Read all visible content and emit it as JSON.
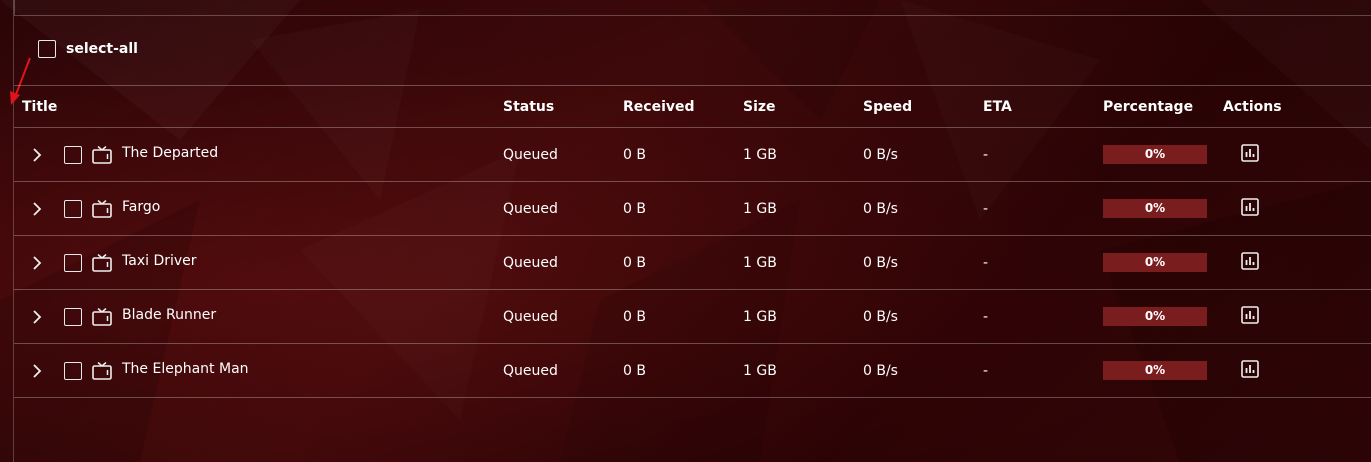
{
  "select_all_label": "select-all",
  "columns": {
    "title": "Title",
    "status": "Status",
    "received": "Received",
    "size": "Size",
    "speed": "Speed",
    "eta": "ETA",
    "percentage": "Percentage",
    "actions": "Actions"
  },
  "rows": [
    {
      "title": "The Departed",
      "status": "Queued",
      "received": "0 B",
      "size": "1 GB",
      "speed": "0 B/s",
      "eta": "-",
      "percentage": "0%",
      "progress": 0
    },
    {
      "title": "Fargo",
      "status": "Queued",
      "received": "0 B",
      "size": "1 GB",
      "speed": "0 B/s",
      "eta": "-",
      "percentage": "0%",
      "progress": 0
    },
    {
      "title": "Taxi Driver",
      "status": "Queued",
      "received": "0 B",
      "size": "1 GB",
      "speed": "0 B/s",
      "eta": "-",
      "percentage": "0%",
      "progress": 0
    },
    {
      "title": "Blade Runner",
      "status": "Queued",
      "received": "0 B",
      "size": "1 GB",
      "speed": "0 B/s",
      "eta": "-",
      "percentage": "0%",
      "progress": 0
    },
    {
      "title": "The Elephant Man",
      "status": "Queued",
      "received": "0 B",
      "size": "1 GB",
      "speed": "0 B/s",
      "eta": "-",
      "percentage": "0%",
      "progress": 0
    }
  ],
  "icons": {
    "expand": "chevron-right-icon",
    "media": "tv-icon",
    "action": "bar-chart-icon"
  },
  "colors": {
    "background": "#2f0507",
    "progress_bar": "#7a1d1f",
    "annotation_arrow": "#e0141a"
  }
}
